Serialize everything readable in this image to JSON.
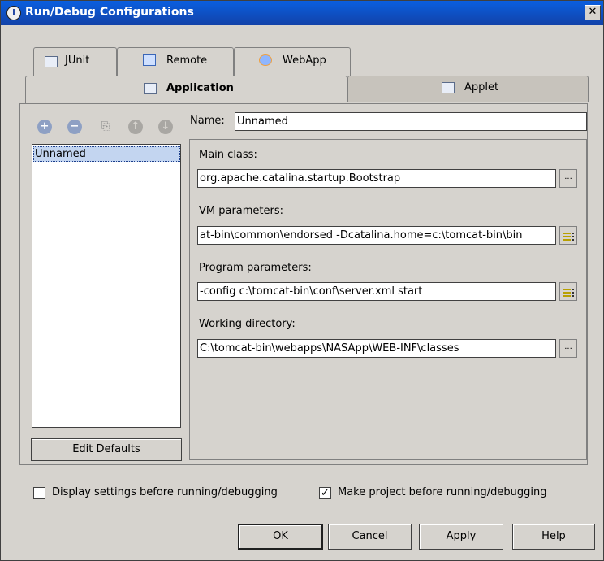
{
  "window": {
    "title": "Run/Debug Configurations",
    "close_symbol": "✕"
  },
  "tabs_row1": [
    {
      "label": "JUnit",
      "icon": "junit-icon"
    },
    {
      "label": "Remote",
      "icon": "remote-icon"
    },
    {
      "label": "WebApp",
      "icon": "webapp-icon"
    }
  ],
  "tabs_row2": [
    {
      "label": "Application",
      "icon": "application-icon",
      "active": true
    },
    {
      "label": "Applet",
      "icon": "applet-icon",
      "active": false
    }
  ],
  "toolbar": {
    "add": "+",
    "remove": "−",
    "copy": "⎘",
    "up": "↑",
    "down": "↓"
  },
  "config_list": {
    "items": [
      "Unnamed"
    ],
    "selected": "Unnamed"
  },
  "edit_defaults_label": "Edit Defaults",
  "form": {
    "name_label": "Name:",
    "name_value": "Unnamed",
    "main_class_label": "Main class:",
    "main_class_value": "org.apache.catalina.startup.Bootstrap",
    "vm_params_label": "VM parameters:",
    "vm_params_value": "at-bin\\common\\endorsed -Dcatalina.home=c:\\tomcat-bin\\bin",
    "program_params_label": "Program parameters:",
    "program_params_value": "-config c:\\tomcat-bin\\conf\\server.xml start",
    "working_dir_label": "Working directory:",
    "working_dir_value": "C:\\tomcat-bin\\webapps\\NASApp\\WEB-INF\\classes",
    "browse_label": "..."
  },
  "options": {
    "display_settings": {
      "label": "Display settings before running/debugging",
      "checked": false
    },
    "make_project": {
      "label": "Make project before running/debugging",
      "checked": true
    }
  },
  "buttons": {
    "ok": "OK",
    "cancel": "Cancel",
    "apply": "Apply",
    "help": "Help"
  }
}
